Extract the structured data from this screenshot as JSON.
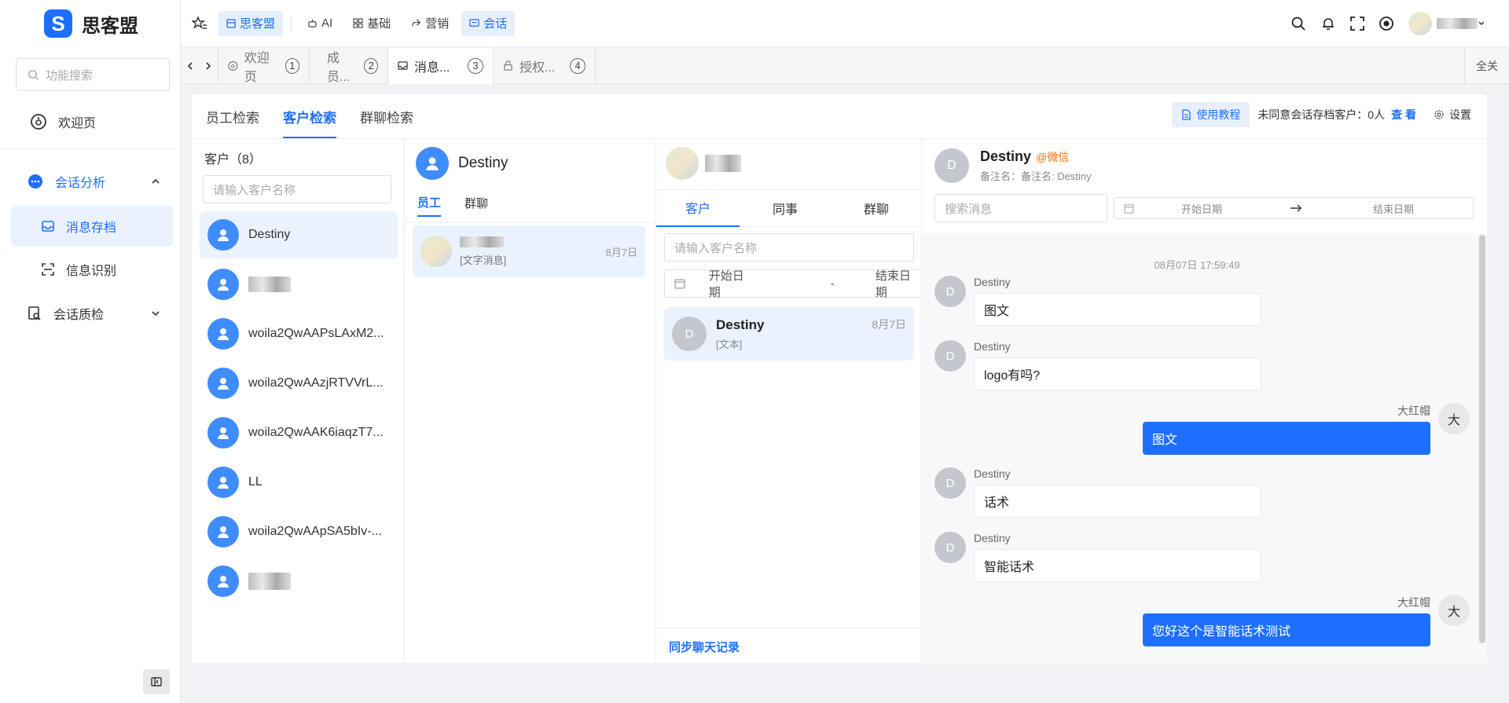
{
  "app": {
    "logo_char": "S",
    "name": "思客盟"
  },
  "sidebar": {
    "search_placeholder": "功能搜索",
    "welcome": "欢迎页",
    "analysis": "会话分析",
    "archive": "消息存档",
    "recognition": "信息识别",
    "quality": "会话质检"
  },
  "topbar": {
    "items": [
      "思客盟",
      "AI",
      "基础",
      "营销",
      "会话"
    ]
  },
  "pagetabs": [
    {
      "label": "欢迎页",
      "num": "1"
    },
    {
      "label": "成员...",
      "num": "2"
    },
    {
      "label": "消息...",
      "num": "3"
    },
    {
      "label": "授权...",
      "num": "4"
    }
  ],
  "close_all": "全关",
  "subtabs": [
    "员工检索",
    "客户检索",
    "群聊检索"
  ],
  "header_right": {
    "tutorial": "使用教程",
    "unagreed": "未同意会话存档客户：0人",
    "view": "查 看",
    "settings": "设置"
  },
  "customers": {
    "title": "客户（8）",
    "placeholder": "请输入客户名称",
    "list": [
      "Destiny",
      "",
      "woila2QwAAPsLAxM2...",
      "woila2QwAAzjRTVVrL...",
      "woila2QwAAK6iaqzT7...",
      "LL",
      "woila2QwAApSA5bIv-...",
      ""
    ]
  },
  "col2": {
    "name": "Destiny",
    "tabs": [
      "员工",
      "群聊"
    ],
    "item": {
      "preview": "[文字消息]",
      "date": "8月7日"
    }
  },
  "col3": {
    "tabs": [
      "客户",
      "同事",
      "群聊"
    ],
    "placeholder": "请输入客户名称",
    "start": "开始日期",
    "sep": "-",
    "end": "结束日期",
    "item": {
      "avatar": "D",
      "name": "Destiny",
      "preview": "[文本]",
      "date": "8月7日"
    },
    "sync": "同步聊天记录"
  },
  "chat": {
    "avatar": "D",
    "name": "Destiny",
    "tag": "@微信",
    "remark": "备注名：备注名: Destiny",
    "search_placeholder": "搜索消息",
    "start": "开始日期",
    "end": "结束日期",
    "timestamp": "08月07日 17:59:49",
    "messages": [
      {
        "sender": "Destiny",
        "avatar": "D",
        "text": "图文"
      },
      {
        "sender": "Destiny",
        "avatar": "D",
        "text": "logo有吗?"
      },
      {
        "sender": "大红帽",
        "avatar": "大",
        "text": "图文"
      },
      {
        "sender": "Destiny",
        "avatar": "D",
        "text": "话术"
      },
      {
        "sender": "Destiny",
        "avatar": "D",
        "text": "智能话术"
      },
      {
        "sender": "大红帽",
        "avatar": "大",
        "text": "您好这个是智能话术测试"
      }
    ]
  },
  "colors": {
    "accent": "#1e6fff",
    "avatar_blue": "#3f8cff",
    "orange": "#ff6a00"
  }
}
